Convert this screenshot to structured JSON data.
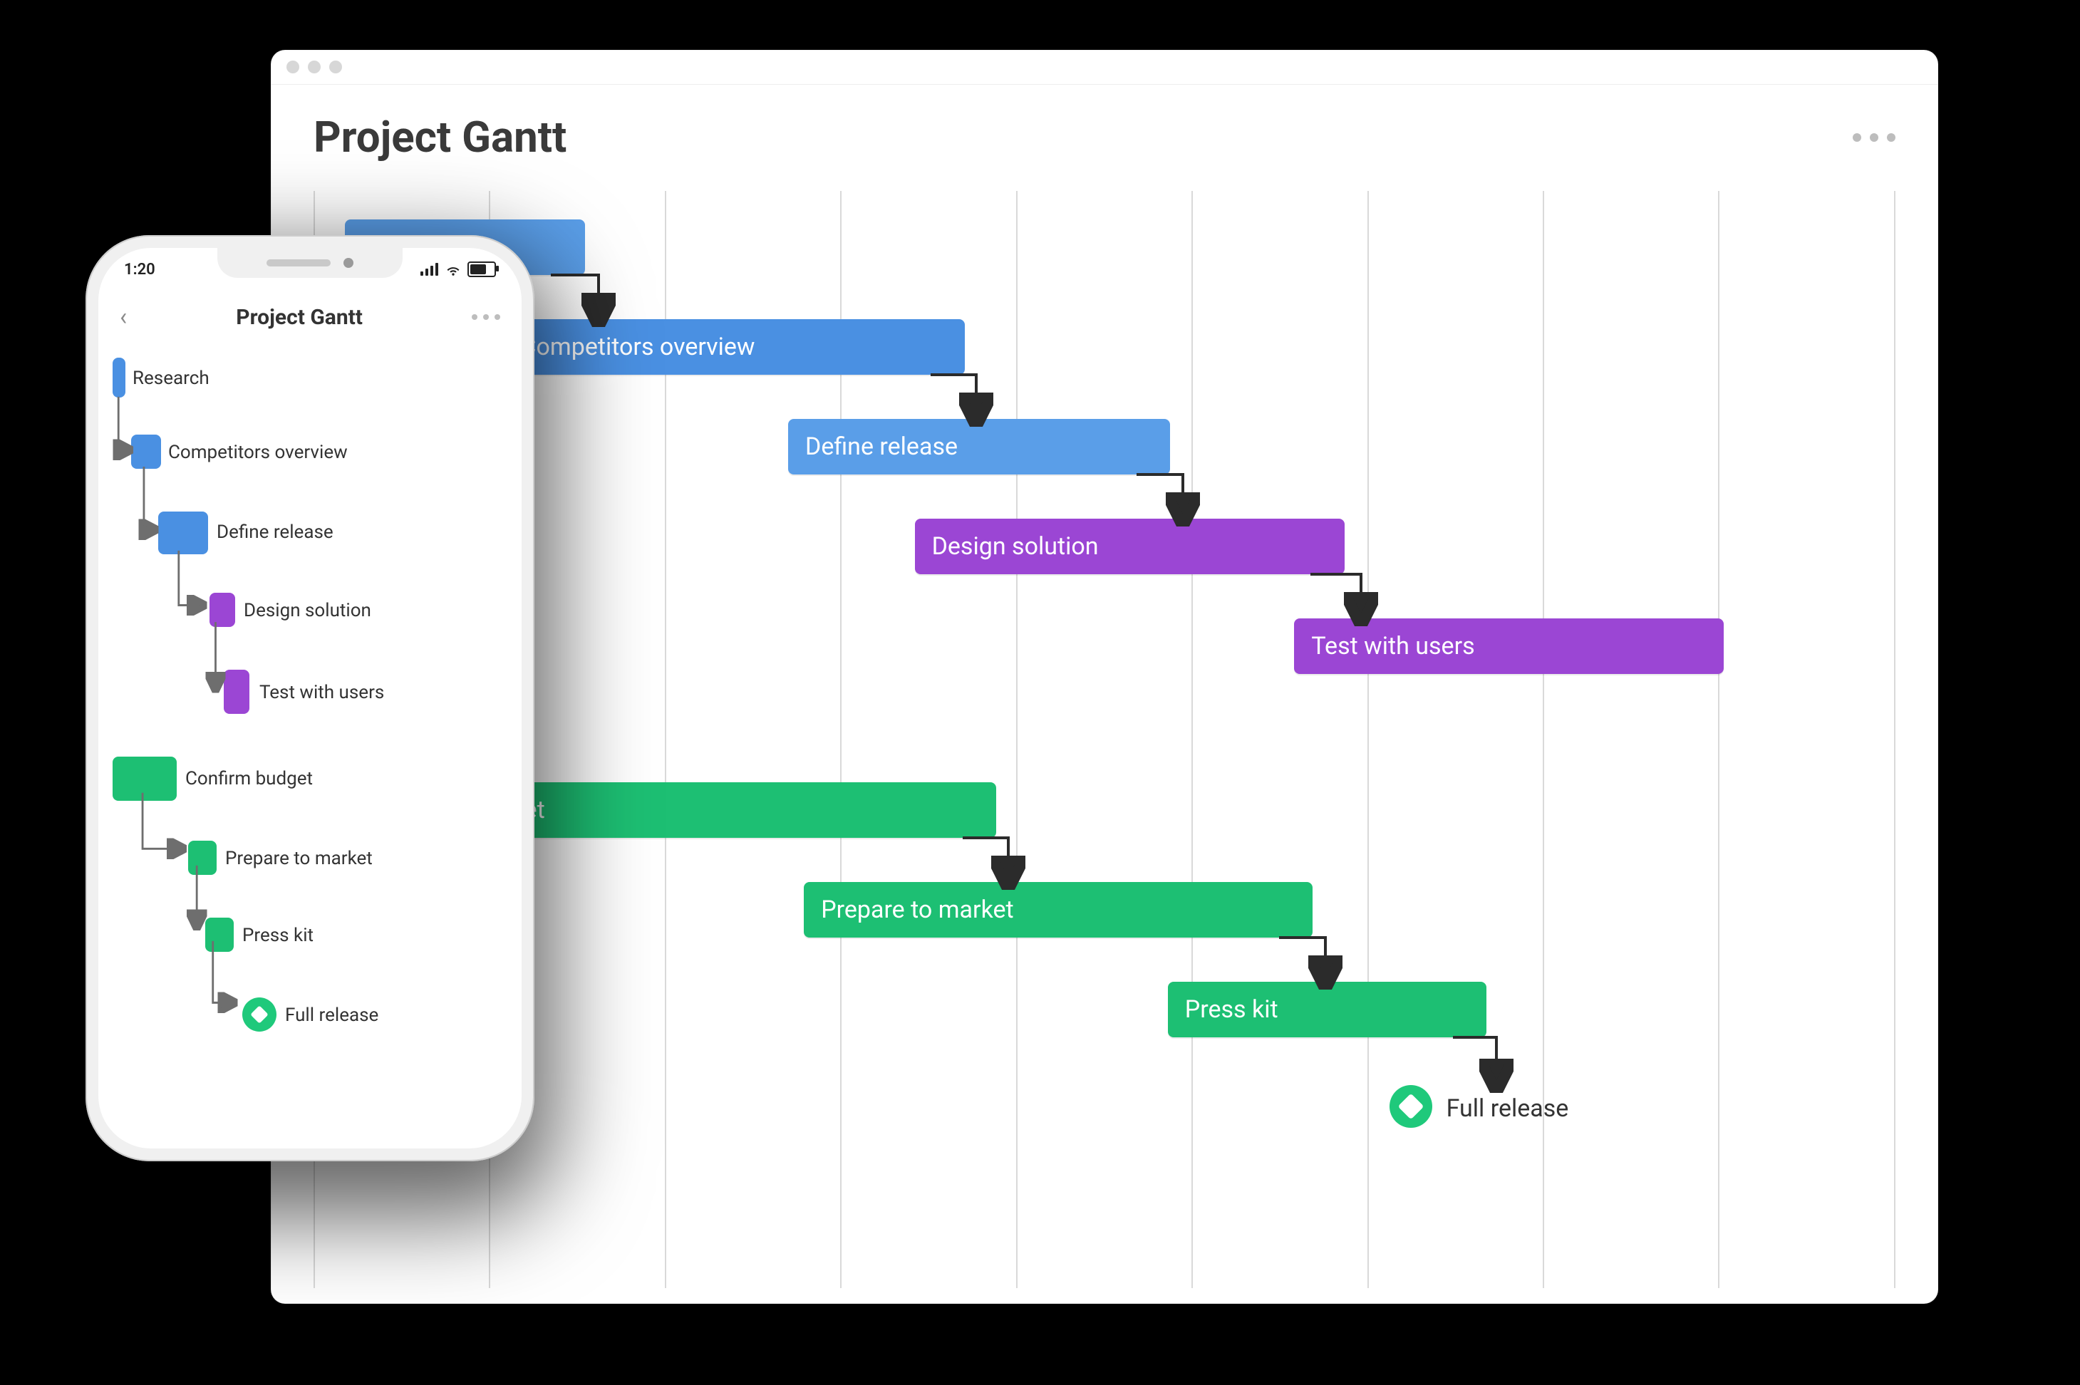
{
  "colors": {
    "blue": "#4a90e2",
    "purple": "#9b46d4",
    "green": "#1dbf73"
  },
  "window": {
    "title": "Project Gantt"
  },
  "phone": {
    "time": "1:20",
    "title": "Project Gantt"
  },
  "tasks": [
    {
      "id": "research",
      "label": "Research",
      "color": "blue"
    },
    {
      "id": "competitors",
      "label": "Competitors overview",
      "color": "blue"
    },
    {
      "id": "define",
      "label": "Define release",
      "color": "blue"
    },
    {
      "id": "design",
      "label": "Design solution",
      "color": "purple"
    },
    {
      "id": "test",
      "label": "Test with users",
      "color": "purple"
    },
    {
      "id": "budget",
      "label": "Confirm budget",
      "color": "green"
    },
    {
      "id": "market",
      "label": "Prepare to market",
      "color": "green"
    },
    {
      "id": "presskit",
      "label": "Press kit",
      "color": "green"
    }
  ],
  "milestone": {
    "id": "release",
    "label": "Full release",
    "color": "green"
  },
  "chart_data": {
    "type": "gantt",
    "title": "Project Gantt",
    "x_unit": "grid_column",
    "x_range": [
      0,
      9
    ],
    "row_height": 1,
    "tracks": [
      {
        "id": "research",
        "label": "Research",
        "color": "blue",
        "start": 0.2,
        "end": 1.4,
        "row": 0,
        "depends_on": null
      },
      {
        "id": "competitors",
        "label": "Competitors overview",
        "color": "blue",
        "start": 1.1,
        "end": 3.5,
        "row": 1,
        "depends_on": "research"
      },
      {
        "id": "define",
        "label": "Define release",
        "color": "blue",
        "start": 2.7,
        "end": 4.7,
        "row": 2,
        "depends_on": "competitors"
      },
      {
        "id": "design",
        "label": "Design solution",
        "color": "purple",
        "start": 3.4,
        "end": 5.7,
        "row": 3,
        "depends_on": "define"
      },
      {
        "id": "test",
        "label": "Test with users",
        "color": "purple",
        "start": 5.6,
        "end": 7.8,
        "row": 4,
        "depends_on": "design"
      },
      {
        "id": "budget",
        "label": "Confirm budget",
        "color": "green",
        "start": 0.3,
        "end": 3.7,
        "row": 6,
        "depends_on": null
      },
      {
        "id": "market",
        "label": "Prepare to market",
        "color": "green",
        "start": 2.8,
        "end": 5.5,
        "row": 7,
        "depends_on": "budget"
      },
      {
        "id": "presskit",
        "label": "Press kit",
        "color": "green",
        "start": 4.9,
        "end": 6.5,
        "row": 8,
        "depends_on": "market"
      }
    ],
    "milestones": [
      {
        "id": "release",
        "label": "Full release",
        "color": "green",
        "at": 6.2,
        "row": 9,
        "depends_on": "presskit"
      }
    ],
    "dependencies": [
      [
        "research",
        "competitors"
      ],
      [
        "competitors",
        "define"
      ],
      [
        "define",
        "design"
      ],
      [
        "design",
        "test"
      ],
      [
        "budget",
        "market"
      ],
      [
        "market",
        "presskit"
      ],
      [
        "presskit",
        "release"
      ]
    ]
  }
}
